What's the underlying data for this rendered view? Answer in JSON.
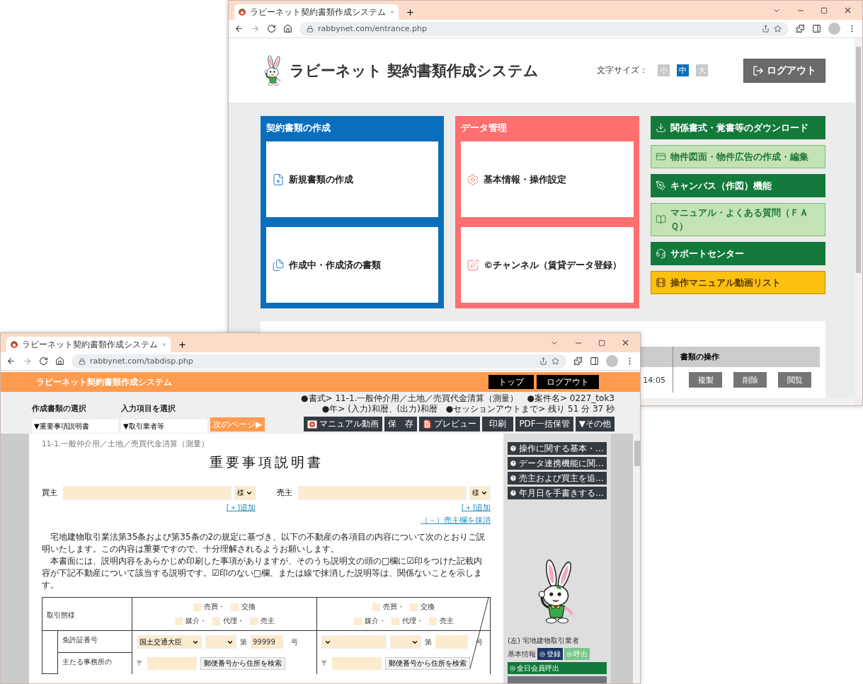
{
  "back_window": {
    "tab_title": "ラビーネット契約書類作成システム",
    "url": "rabbynet.com/entrance.php",
    "header": {
      "title": "ラビーネット 契約書類作成システム",
      "font_size_label": "文字サイズ：",
      "font_sizes": [
        {
          "label": "小",
          "selected": false
        },
        {
          "label": "中",
          "selected": true
        },
        {
          "label": "大",
          "selected": false
        }
      ],
      "logout": "ログアウト"
    },
    "panels": [
      {
        "title": "契約書類の作成",
        "kind": "blue",
        "cards": [
          "新規書類の作成",
          "作成中・作成済の書類"
        ]
      },
      {
        "title": "データ管理",
        "kind": "red",
        "cards": [
          "基本情報・操作設定",
          "©チャンネル（賃貸データ登録）"
        ]
      }
    ],
    "links": [
      {
        "label": "関係書式・覚書等のダウンロード",
        "kind": "dark"
      },
      {
        "label": "物件図面・物件広告の作成・編集",
        "kind": "light"
      },
      {
        "label": "キャンバス（作図）機能",
        "kind": "dark"
      },
      {
        "label": "マニュアル・よくある質問（ＦＡＱ）",
        "kind": "light"
      },
      {
        "label": "サポートセンター",
        "kind": "dark"
      },
      {
        "label": "操作マニュアル動画リスト",
        "kind": "yellow"
      }
    ],
    "table": {
      "columns": [
        "書類の操作"
      ],
      "rows": [
        {
          "time": "14:05",
          "actions": [
            "複製",
            "削除",
            "閲覧"
          ]
        }
      ]
    }
  },
  "front_window": {
    "tab_title": "ラビーネット契約書類作成システム",
    "url": "rabbynet.com/tabdisp.php",
    "app_title": "ラビーネット契約書類作成システム",
    "nav_buttons": [
      "トップ",
      "ログアウト"
    ],
    "selectors": [
      {
        "label": "作成書類の選択",
        "value": "▼重要事項説明書"
      },
      {
        "label": "入力項目を選択",
        "value": "▼取引業者等"
      }
    ],
    "next_page": "次のページ▶",
    "info_lines": [
      "●書式> 11-1.一般仲介用／土地／売買代金清算（測量）　●案件名> 0227_tok3",
      "●年> (入力)和暦、(出力)和暦　●セッションアウトまで> 残り 51 分 37 秒"
    ],
    "actions": [
      "マニュアル動画",
      "保　存",
      "プレビュー",
      "印刷",
      "PDF一括保管",
      "▼その他"
    ],
    "document": {
      "breadcrumb": "11-1.一般仲介用／土地／売買代金清算（測量）",
      "title": "重要事項説明書",
      "parties": [
        {
          "label": "買主",
          "honorific": "様",
          "links": [
            "[＋]追加"
          ]
        },
        {
          "label": "売主",
          "honorific": "様",
          "links": [
            "[＋]追加",
            "（－）売主欄を抹消"
          ]
        }
      ],
      "paragraphs": [
        "宅地建物取引業法第35条および第35条の2の規定に基づき、以下の不動産の各項目の内容について次のとおりご説明いたします。この内容は重要ですので、十分理解されるようお願いします。",
        "本書面には、説明内容をあらかじめ印刷した事項がありますが、そのうち説明文の頭の□欄に☑印をつけた記載内容が下記不動産について該当する説明です。☑印のない□欄、または線で抹消した説明等は、関係ないことを示します。"
      ],
      "trade_type": {
        "label": "取引態様",
        "cells": [
          [
            [
              {
                "label": "売買・",
                "checked": false
              },
              {
                "label": "交換",
                "checked": false
              }
            ],
            [
              {
                "label": "媒介・",
                "checked": false
              },
              {
                "label": "代理・",
                "checked": false
              },
              {
                "label": "売主",
                "checked": false
              }
            ]
          ],
          [
            [
              {
                "label": "売買・",
                "checked": false
              },
              {
                "label": "交換",
                "checked": false
              }
            ],
            [
              {
                "label": "媒介・",
                "checked": false
              },
              {
                "label": "代理・",
                "checked": false
              },
              {
                "label": "売主",
                "checked": false
              }
            ]
          ]
        ]
      },
      "license": {
        "label": "免許証番号",
        "cells": [
          {
            "authority": "国土交通大臣",
            "prefix": "第",
            "number": "99999",
            "suffix": "号"
          },
          {
            "prefix": "第",
            "suffix": "号"
          }
        ]
      },
      "office": {
        "label": "主たる事務所の",
        "cells": [
          {
            "postal_mark": "〒",
            "search_button": "郵便番号から住所を検索"
          },
          {
            "postal_mark": "〒",
            "search_button": "郵便番号から住所を検索"
          }
        ]
      }
    },
    "sidebar": {
      "help": [
        "操作に関する基本・…",
        "データ連携機能に関…",
        "売主および買主を追…",
        "年月日を手書きする…"
      ],
      "agent_label": "(左) 宅地建物取引業者",
      "basic_label": "基本情報",
      "register": "登録",
      "recall": "呼出",
      "member_recall": "全日会員呼出"
    }
  }
}
